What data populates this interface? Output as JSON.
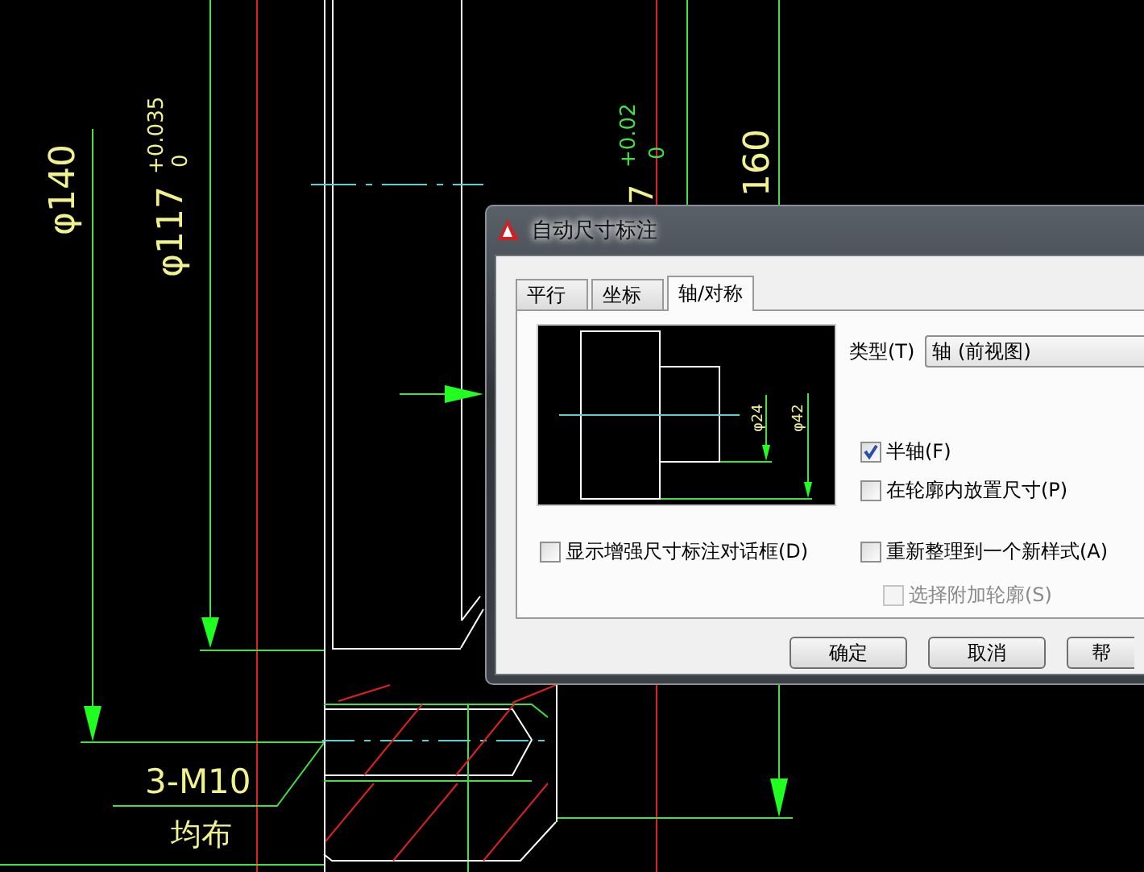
{
  "drawing_texts": [
    {
      "text": "φ140",
      "kind": "dimension"
    },
    {
      "text": "φ117",
      "kind": "dimension"
    },
    {
      "text": "+0.035",
      "kind": "tolerance"
    },
    {
      "text": "0",
      "kind": "tolerance"
    },
    {
      "text": "7",
      "kind": "dimension"
    },
    {
      "text": "+0.02",
      "kind": "tolerance-green"
    },
    {
      "text": "0",
      "kind": "tolerance-green"
    },
    {
      "text": "160",
      "kind": "dimension"
    },
    {
      "text": "3-M10",
      "kind": "note"
    },
    {
      "text": "均布",
      "kind": "note"
    }
  ],
  "dialog": {
    "title": "自动尺寸标注",
    "tabs": [
      {
        "label": "平行",
        "selected": false
      },
      {
        "label": "坐标",
        "selected": false
      },
      {
        "label": "轴/对称",
        "selected": true
      }
    ],
    "preview_labels": [
      "φ24",
      "φ42"
    ],
    "type_label": "类型(T)",
    "type_value": "轴 (前视图)",
    "shaft_options": [
      {
        "label": "半轴(F)",
        "checked": true
      },
      {
        "label": "在轮廓内放置尺寸(P)",
        "checked": false
      }
    ],
    "dialog_option": {
      "label": "显示增强尺寸标注对话框(D)",
      "checked": false
    },
    "style_option": {
      "label": "重新整理到一个新样式(A)",
      "checked": false,
      "children": [
        {
          "label": "选择附加轮廓(S)",
          "checked": false,
          "disabled": true
        }
      ]
    },
    "buttons": [
      "确定",
      "取消",
      "帮"
    ]
  }
}
